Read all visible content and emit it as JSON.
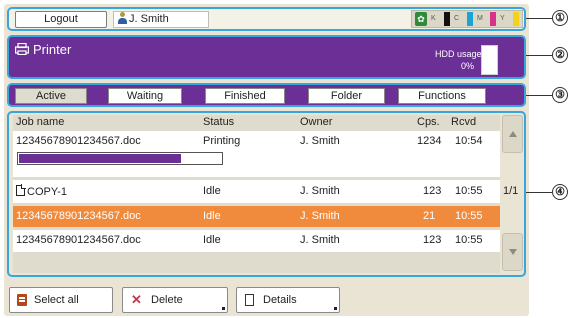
{
  "topbar": {
    "logout_label": "Logout",
    "user_name": "J. Smith",
    "toner": [
      {
        "label": "K",
        "color": "#111111"
      },
      {
        "label": "C",
        "color": "#1aa3d6"
      },
      {
        "label": "M",
        "color": "#d6338a"
      },
      {
        "label": "Y",
        "color": "#f2d21b"
      }
    ]
  },
  "header": {
    "title": "Printer",
    "hdd_label": "HDD usage",
    "hdd_value": "0%"
  },
  "tabs": [
    {
      "label": "Active",
      "active": true
    },
    {
      "label": "Waiting"
    },
    {
      "label": "Finished"
    },
    {
      "label": "Folder"
    },
    {
      "label": "Functions"
    }
  ],
  "table": {
    "columns": [
      "Job name",
      "Status",
      "Owner",
      "Cps.",
      "Rcvd"
    ],
    "rows": [
      {
        "job": "12345678901234567.doc",
        "status": "Printing",
        "owner": "J. Smith",
        "copies": "1234",
        "received": "10:54",
        "progress": 0.8
      },
      {
        "job": "COPY-1",
        "status": "Idle",
        "owner": "J. Smith",
        "copies": "123",
        "received": "10:55"
      },
      {
        "job": "12345678901234567.doc",
        "status": "Idle",
        "owner": "J. Smith",
        "copies": "21",
        "received": "10:55",
        "selected": true
      },
      {
        "job": "12345678901234567.doc",
        "status": "Idle",
        "owner": "J. Smith",
        "copies": "123",
        "received": "10:55"
      }
    ],
    "page": "1/1"
  },
  "buttons": {
    "select_all": "Select all",
    "delete": "Delete",
    "details": "Details"
  },
  "callouts": [
    "①",
    "②",
    "③",
    "④"
  ],
  "colors": {
    "accent_purple": "#6b2f96",
    "frame_blue": "#38a5dc",
    "selected_orange": "#f08a3c"
  }
}
